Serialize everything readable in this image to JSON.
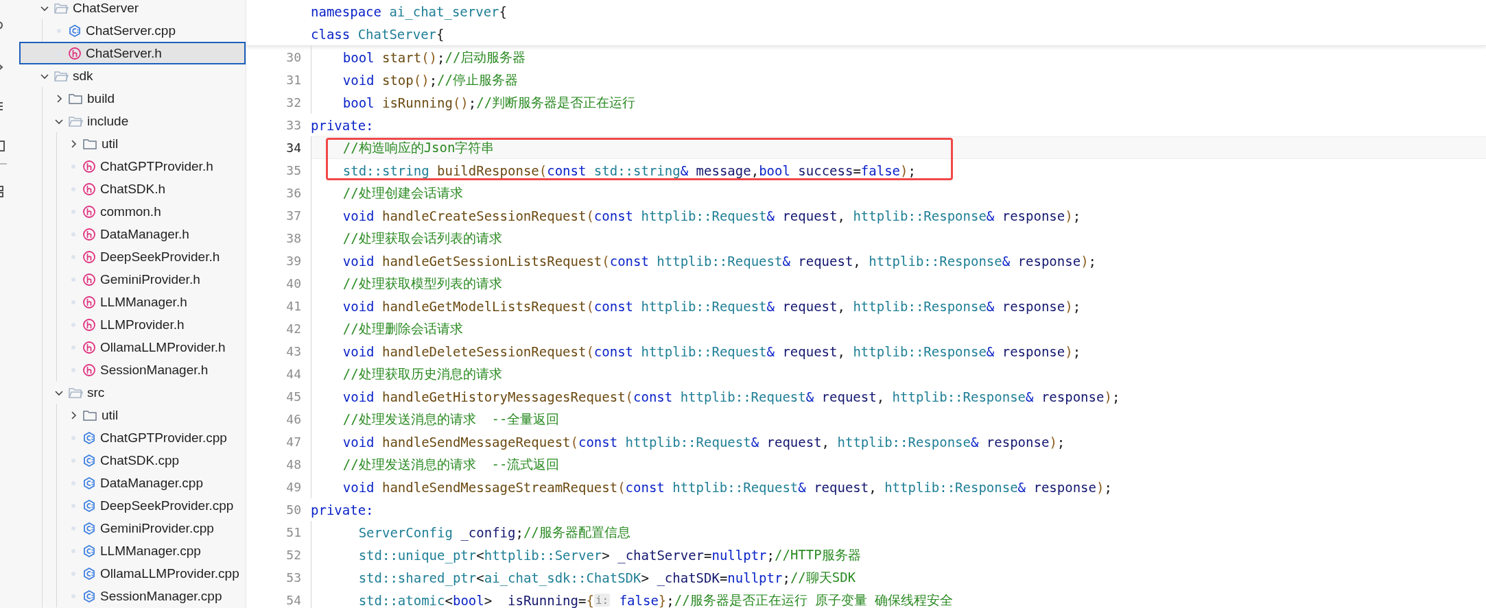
{
  "explorer": {
    "items": [
      {
        "name": "ChatServer",
        "kind": "folder",
        "expanded": true,
        "selected": false,
        "children": [
          {
            "name": "ChatServer.cpp",
            "kind": "cpp",
            "selected": false
          },
          {
            "name": "ChatServer.h",
            "kind": "header",
            "selected": true
          }
        ]
      },
      {
        "name": "sdk",
        "kind": "folder",
        "expanded": true,
        "selected": false,
        "children": [
          {
            "name": "build",
            "kind": "folder",
            "expanded": false,
            "selected": false
          },
          {
            "name": "include",
            "kind": "folder",
            "expanded": true,
            "selected": false,
            "children": [
              {
                "name": "util",
                "kind": "folder",
                "expanded": false,
                "selected": false
              },
              {
                "name": "ChatGPTProvider.h",
                "kind": "header",
                "selected": false
              },
              {
                "name": "ChatSDK.h",
                "kind": "header",
                "selected": false
              },
              {
                "name": "common.h",
                "kind": "header",
                "selected": false
              },
              {
                "name": "DataManager.h",
                "kind": "header",
                "selected": false
              },
              {
                "name": "DeepSeekProvider.h",
                "kind": "header",
                "selected": false
              },
              {
                "name": "GeminiProvider.h",
                "kind": "header",
                "selected": false
              },
              {
                "name": "LLMManager.h",
                "kind": "header",
                "selected": false
              },
              {
                "name": "LLMProvider.h",
                "kind": "header",
                "selected": false
              },
              {
                "name": "OllamaLLMProvider.h",
                "kind": "header",
                "selected": false
              },
              {
                "name": "SessionManager.h",
                "kind": "header",
                "selected": false
              }
            ]
          },
          {
            "name": "src",
            "kind": "folder",
            "expanded": true,
            "selected": false,
            "children": [
              {
                "name": "util",
                "kind": "folder",
                "expanded": false,
                "selected": false
              },
              {
                "name": "ChatGPTProvider.cpp",
                "kind": "cpp",
                "selected": false
              },
              {
                "name": "ChatSDK.cpp",
                "kind": "cpp",
                "selected": false
              },
              {
                "name": "DataManager.cpp",
                "kind": "cpp",
                "selected": false
              },
              {
                "name": "DeepSeekProvider.cpp",
                "kind": "cpp",
                "selected": false
              },
              {
                "name": "GeminiProvider.cpp",
                "kind": "cpp",
                "selected": false
              },
              {
                "name": "LLMManager.cpp",
                "kind": "cpp",
                "selected": false
              },
              {
                "name": "OllamaLLMProvider.cpp",
                "kind": "cpp",
                "selected": false
              },
              {
                "name": "SessionManager.cpp",
                "kind": "cpp",
                "selected": false
              }
            ]
          }
        ]
      }
    ]
  },
  "editor": {
    "sticky_lines": [
      {
        "tokens": [
          {
            "kind": "kw",
            "text": "namespace"
          },
          {
            "kind": "type",
            "text": " ai_chat_server"
          },
          {
            "kind": "punct",
            "text": "{"
          }
        ]
      },
      {
        "tokens": [
          {
            "kind": "kw",
            "text": "class"
          },
          {
            "kind": "type",
            "text": " ChatServer"
          },
          {
            "kind": "punct",
            "text": "{"
          }
        ]
      }
    ],
    "lines": [
      {
        "number": "30",
        "current": false,
        "boxed": false,
        "tokens": [
          {
            "kind": "kw",
            "text": "    bool"
          },
          {
            "kind": "fn",
            "text": " start"
          },
          {
            "kind": "paren",
            "text": "()"
          },
          {
            "kind": "punct",
            "text": ";"
          },
          {
            "kind": "cmt",
            "text": "//启动服务器"
          }
        ]
      },
      {
        "number": "31",
        "current": false,
        "boxed": false,
        "tokens": [
          {
            "kind": "kw",
            "text": "    void"
          },
          {
            "kind": "fn",
            "text": " stop"
          },
          {
            "kind": "paren",
            "text": "()"
          },
          {
            "kind": "punct",
            "text": ";"
          },
          {
            "kind": "cmt",
            "text": "//停止服务器"
          }
        ]
      },
      {
        "number": "32",
        "current": false,
        "boxed": false,
        "tokens": [
          {
            "kind": "kw",
            "text": "    bool"
          },
          {
            "kind": "fn",
            "text": " isRunning"
          },
          {
            "kind": "paren",
            "text": "()"
          },
          {
            "kind": "punct",
            "text": ";"
          },
          {
            "kind": "cmt",
            "text": "//判断服务器是否正在运行"
          }
        ]
      },
      {
        "number": "33",
        "current": false,
        "boxed": false,
        "tokens": [
          {
            "kind": "kw",
            "text": "private:"
          }
        ]
      },
      {
        "number": "34",
        "current": true,
        "boxed": true,
        "tokens": [
          {
            "kind": "cmt",
            "text": "    //构造响应的Json字符串"
          }
        ]
      },
      {
        "number": "35",
        "current": false,
        "boxed": true,
        "tokens": [
          {
            "kind": "type",
            "text": "    std::string"
          },
          {
            "kind": "fn",
            "text": " buildResponse"
          },
          {
            "kind": "paren",
            "text": "("
          },
          {
            "kind": "kw",
            "text": "const"
          },
          {
            "kind": "type",
            "text": " std::string"
          },
          {
            "kind": "kw",
            "text": "&"
          },
          {
            "kind": "param",
            "text": " message"
          },
          {
            "kind": "punct",
            "text": ","
          },
          {
            "kind": "kw",
            "text": "bool"
          },
          {
            "kind": "param",
            "text": " success"
          },
          {
            "kind": "punct",
            "text": "="
          },
          {
            "kind": "kw",
            "text": "false"
          },
          {
            "kind": "paren",
            "text": ")"
          },
          {
            "kind": "punct",
            "text": ";"
          }
        ]
      },
      {
        "number": "36",
        "current": false,
        "boxed": false,
        "tokens": [
          {
            "kind": "cmt",
            "text": "    //处理创建会话请求"
          }
        ]
      },
      {
        "number": "37",
        "current": false,
        "boxed": false,
        "tokens": [
          {
            "kind": "kw",
            "text": "    void"
          },
          {
            "kind": "fn",
            "text": " handleCreateSessionRequest"
          },
          {
            "kind": "paren",
            "text": "("
          },
          {
            "kind": "kw",
            "text": "const"
          },
          {
            "kind": "type",
            "text": " httplib::Request"
          },
          {
            "kind": "kw",
            "text": "&"
          },
          {
            "kind": "param",
            "text": " request"
          },
          {
            "kind": "punct",
            "text": ", "
          },
          {
            "kind": "type",
            "text": "httplib::Response"
          },
          {
            "kind": "kw",
            "text": "&"
          },
          {
            "kind": "param",
            "text": " response"
          },
          {
            "kind": "paren",
            "text": ")"
          },
          {
            "kind": "punct",
            "text": ";"
          }
        ]
      },
      {
        "number": "38",
        "current": false,
        "boxed": false,
        "tokens": [
          {
            "kind": "cmt",
            "text": "    //处理获取会话列表的请求"
          }
        ]
      },
      {
        "number": "39",
        "current": false,
        "boxed": false,
        "tokens": [
          {
            "kind": "kw",
            "text": "    void"
          },
          {
            "kind": "fn",
            "text": " handleGetSessionListsRequest"
          },
          {
            "kind": "paren",
            "text": "("
          },
          {
            "kind": "kw",
            "text": "const"
          },
          {
            "kind": "type",
            "text": " httplib::Request"
          },
          {
            "kind": "kw",
            "text": "&"
          },
          {
            "kind": "param",
            "text": " request"
          },
          {
            "kind": "punct",
            "text": ", "
          },
          {
            "kind": "type",
            "text": "httplib::Response"
          },
          {
            "kind": "kw",
            "text": "&"
          },
          {
            "kind": "param",
            "text": " response"
          },
          {
            "kind": "paren",
            "text": ")"
          },
          {
            "kind": "punct",
            "text": ";"
          }
        ]
      },
      {
        "number": "40",
        "current": false,
        "boxed": false,
        "tokens": [
          {
            "kind": "cmt",
            "text": "    //处理获取模型列表的请求"
          }
        ]
      },
      {
        "number": "41",
        "current": false,
        "boxed": false,
        "tokens": [
          {
            "kind": "kw",
            "text": "    void"
          },
          {
            "kind": "fn",
            "text": " handleGetModelListsRequest"
          },
          {
            "kind": "paren",
            "text": "("
          },
          {
            "kind": "kw",
            "text": "const"
          },
          {
            "kind": "type",
            "text": " httplib::Request"
          },
          {
            "kind": "kw",
            "text": "&"
          },
          {
            "kind": "param",
            "text": " request"
          },
          {
            "kind": "punct",
            "text": ", "
          },
          {
            "kind": "type",
            "text": "httplib::Response"
          },
          {
            "kind": "kw",
            "text": "&"
          },
          {
            "kind": "param",
            "text": " response"
          },
          {
            "kind": "paren",
            "text": ")"
          },
          {
            "kind": "punct",
            "text": ";"
          }
        ]
      },
      {
        "number": "42",
        "current": false,
        "boxed": false,
        "tokens": [
          {
            "kind": "cmt",
            "text": "    //处理删除会话请求"
          }
        ]
      },
      {
        "number": "43",
        "current": false,
        "boxed": false,
        "tokens": [
          {
            "kind": "kw",
            "text": "    void"
          },
          {
            "kind": "fn",
            "text": " handleDeleteSessionRequest"
          },
          {
            "kind": "paren",
            "text": "("
          },
          {
            "kind": "kw",
            "text": "const"
          },
          {
            "kind": "type",
            "text": " httplib::Request"
          },
          {
            "kind": "kw",
            "text": "&"
          },
          {
            "kind": "param",
            "text": " request"
          },
          {
            "kind": "punct",
            "text": ", "
          },
          {
            "kind": "type",
            "text": "httplib::Response"
          },
          {
            "kind": "kw",
            "text": "&"
          },
          {
            "kind": "param",
            "text": " response"
          },
          {
            "kind": "paren",
            "text": ")"
          },
          {
            "kind": "punct",
            "text": ";"
          }
        ]
      },
      {
        "number": "44",
        "current": false,
        "boxed": false,
        "tokens": [
          {
            "kind": "cmt",
            "text": "    //处理获取历史消息的请求"
          }
        ]
      },
      {
        "number": "45",
        "current": false,
        "boxed": false,
        "tokens": [
          {
            "kind": "kw",
            "text": "    void"
          },
          {
            "kind": "fn",
            "text": " handleGetHistoryMessagesRequest"
          },
          {
            "kind": "paren",
            "text": "("
          },
          {
            "kind": "kw",
            "text": "const"
          },
          {
            "kind": "type",
            "text": " httplib::Request"
          },
          {
            "kind": "kw",
            "text": "&"
          },
          {
            "kind": "param",
            "text": " request"
          },
          {
            "kind": "punct",
            "text": ", "
          },
          {
            "kind": "type",
            "text": "httplib::Response"
          },
          {
            "kind": "kw",
            "text": "&"
          },
          {
            "kind": "param",
            "text": " response"
          },
          {
            "kind": "paren",
            "text": ")"
          },
          {
            "kind": "punct",
            "text": ";"
          }
        ]
      },
      {
        "number": "46",
        "current": false,
        "boxed": false,
        "tokens": [
          {
            "kind": "cmt",
            "text": "    //处理发送消息的请求  --全量返回"
          }
        ]
      },
      {
        "number": "47",
        "current": false,
        "boxed": false,
        "tokens": [
          {
            "kind": "kw",
            "text": "    void"
          },
          {
            "kind": "fn",
            "text": " handleSendMessageRequest"
          },
          {
            "kind": "paren",
            "text": "("
          },
          {
            "kind": "kw",
            "text": "const"
          },
          {
            "kind": "type",
            "text": " httplib::Request"
          },
          {
            "kind": "kw",
            "text": "&"
          },
          {
            "kind": "param",
            "text": " request"
          },
          {
            "kind": "punct",
            "text": ", "
          },
          {
            "kind": "type",
            "text": "httplib::Response"
          },
          {
            "kind": "kw",
            "text": "&"
          },
          {
            "kind": "param",
            "text": " response"
          },
          {
            "kind": "paren",
            "text": ")"
          },
          {
            "kind": "punct",
            "text": ";"
          }
        ]
      },
      {
        "number": "48",
        "current": false,
        "boxed": false,
        "tokens": [
          {
            "kind": "cmt",
            "text": "    //处理发送消息的请求  --流式返回"
          }
        ]
      },
      {
        "number": "49",
        "current": false,
        "boxed": false,
        "tokens": [
          {
            "kind": "kw",
            "text": "    void"
          },
          {
            "kind": "fn",
            "text": " handleSendMessageStreamRequest"
          },
          {
            "kind": "paren",
            "text": "("
          },
          {
            "kind": "kw",
            "text": "const"
          },
          {
            "kind": "type",
            "text": " httplib::Request"
          },
          {
            "kind": "kw",
            "text": "&"
          },
          {
            "kind": "param",
            "text": " request"
          },
          {
            "kind": "punct",
            "text": ", "
          },
          {
            "kind": "type",
            "text": "httplib::Response"
          },
          {
            "kind": "kw",
            "text": "&"
          },
          {
            "kind": "param",
            "text": " response"
          },
          {
            "kind": "paren",
            "text": ")"
          },
          {
            "kind": "punct",
            "text": ";"
          }
        ]
      },
      {
        "number": "50",
        "current": false,
        "boxed": false,
        "tokens": [
          {
            "kind": "kw",
            "text": "private:"
          }
        ]
      },
      {
        "number": "51",
        "current": false,
        "boxed": false,
        "tokens": [
          {
            "kind": "type",
            "text": "      ServerConfig"
          },
          {
            "kind": "param",
            "text": " _config"
          },
          {
            "kind": "punct",
            "text": ";"
          },
          {
            "kind": "cmt",
            "text": "//服务器配置信息"
          }
        ]
      },
      {
        "number": "52",
        "current": false,
        "boxed": false,
        "tokens": [
          {
            "kind": "type",
            "text": "      std::unique_ptr"
          },
          {
            "kind": "punct",
            "text": "<"
          },
          {
            "kind": "type",
            "text": "httplib::Server"
          },
          {
            "kind": "punct",
            "text": ">"
          },
          {
            "kind": "param",
            "text": " _chatServer"
          },
          {
            "kind": "punct",
            "text": "="
          },
          {
            "kind": "kw",
            "text": "nullptr"
          },
          {
            "kind": "punct",
            "text": ";"
          },
          {
            "kind": "cmt",
            "text": "//HTTP服务器"
          }
        ]
      },
      {
        "number": "53",
        "current": false,
        "boxed": false,
        "tokens": [
          {
            "kind": "type",
            "text": "      std::shared_ptr"
          },
          {
            "kind": "punct",
            "text": "<"
          },
          {
            "kind": "type",
            "text": "ai_chat_sdk::ChatSDK"
          },
          {
            "kind": "punct",
            "text": ">"
          },
          {
            "kind": "param",
            "text": " _chatSDK"
          },
          {
            "kind": "punct",
            "text": "="
          },
          {
            "kind": "kw",
            "text": "nullptr"
          },
          {
            "kind": "punct",
            "text": ";"
          },
          {
            "kind": "cmt",
            "text": "//聊天SDK"
          }
        ]
      },
      {
        "number": "54",
        "current": false,
        "boxed": false,
        "tokens": [
          {
            "kind": "type",
            "text": "      std::atomic"
          },
          {
            "kind": "punct",
            "text": "<"
          },
          {
            "kind": "kw",
            "text": "bool"
          },
          {
            "kind": "punct",
            "text": ">"
          },
          {
            "kind": "param",
            "text": " _isRunning"
          },
          {
            "kind": "punct",
            "text": "="
          },
          {
            "kind": "paren",
            "text": "{"
          },
          {
            "kind": "hint",
            "text": "i:"
          },
          {
            "kind": "kw",
            "text": " false"
          },
          {
            "kind": "paren",
            "text": "}"
          },
          {
            "kind": "punct",
            "text": ";"
          },
          {
            "kind": "cmt",
            "text": "//服务器是否正在运行 原子变量 确保线程安全"
          }
        ]
      }
    ]
  }
}
